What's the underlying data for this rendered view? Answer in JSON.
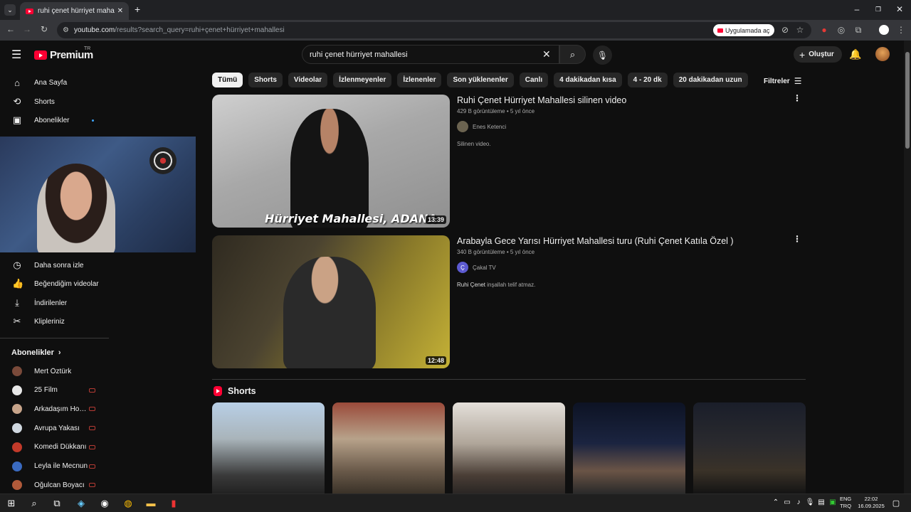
{
  "browser": {
    "tab_title": "ruhi çenet hürriyet mahallesi - YouTube",
    "url_host": "youtube.com",
    "url_path": "/results?search_query=ruhi+çenet+hürriyet+mahallesi",
    "open_in_app": "Uygulamada aç"
  },
  "header": {
    "logo_word": "Premium",
    "logo_region": "TR",
    "search_value": "ruhi çenet hürriyet mahallesi",
    "create_label": "Oluştur"
  },
  "sidebar": {
    "main": [
      {
        "label": "Ana Sayfa",
        "icon": "home-icon"
      },
      {
        "label": "Shorts",
        "icon": "shorts-icon"
      },
      {
        "label": "Abonelikler",
        "icon": "subscriptions-icon"
      }
    ],
    "you": [
      {
        "label": "Daha sonra izle",
        "icon": "clock-icon"
      },
      {
        "label": "Beğendiğim videolar",
        "icon": "thumbs-up-icon"
      },
      {
        "label": "İndirilenler",
        "icon": "download-icon"
      },
      {
        "label": "Klipleriniz",
        "icon": "scissors-icon"
      }
    ],
    "subs_header": "Abonelikler",
    "subscriptions": [
      {
        "label": "Mert Öztürk",
        "color": "#7a4a3a"
      },
      {
        "label": "25 Film",
        "color": "#e8e8e8"
      },
      {
        "label": "Arkadaşım Hoşgeldin",
        "color": "#c7a48a"
      },
      {
        "label": "Avrupa Yakası",
        "color": "#d0d8e0"
      },
      {
        "label": "Komedi Dükkanı",
        "color": "#c23a2a"
      },
      {
        "label": "Leyla ile Mecnun",
        "color": "#3a6ac0"
      },
      {
        "label": "Oğulcan Boyacı",
        "color": "#b05a3a"
      }
    ]
  },
  "chips": [
    "Tümü",
    "Shorts",
    "Videolar",
    "İzlenmeyenler",
    "İzlenenler",
    "Son yüklenenler",
    "Canlı",
    "4 dakikadan kısa",
    "4 - 20 dk",
    "20 dakikadan uzun"
  ],
  "filters_label": "Filtreler",
  "results": [
    {
      "title": "Ruhi Çenet Hürriyet Mahallesi silinen video",
      "views": "429 B görüntüleme",
      "age": "5 yıl önce",
      "channel": "Enes Ketenci",
      "description": "Silinen video.",
      "duration": "13:39",
      "thumb_caption": "Hürriyet Mahallesi, ADANA"
    },
    {
      "title": "Arabayla Gece Yarısı Hürriyet Mahallesi turu (Ruhi Çenet Katıla Özel )",
      "views": "340 B görüntüleme",
      "age": "5 yıl önce",
      "channel": "Çakal TV",
      "channel_initial": "Ç",
      "description_bold": "Ruhi Çenet",
      "description_rest": " inşallah telif atmaz.",
      "duration": "12:48"
    }
  ],
  "shorts_title": "Shorts",
  "taskbar": {
    "lang_top": "ENG",
    "lang_bottom": "TRQ",
    "time": "22:02",
    "date": "16.09.2025"
  },
  "colors": {
    "background": "#0f0f0f",
    "brand_red": "#ff0033"
  }
}
